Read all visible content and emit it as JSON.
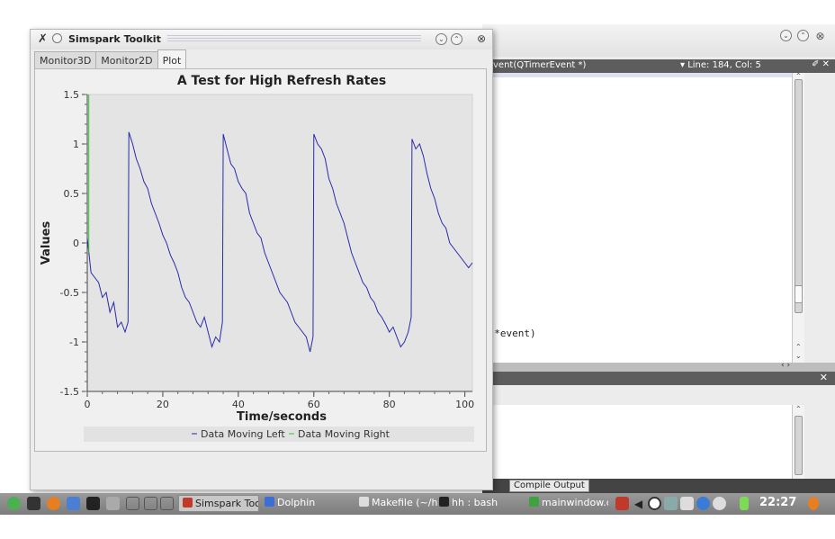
{
  "simspark_window": {
    "title": "Simspark Toolkit",
    "title_buttons": [
      "⌄",
      "⌃"
    ],
    "close": "⊗",
    "tabs": [
      {
        "label": "Monitor3D",
        "active": false
      },
      {
        "label": "Monitor2D",
        "active": false
      },
      {
        "label": "Plot",
        "active": true
      }
    ]
  },
  "chart_data": {
    "type": "line",
    "title": "A Test for High Refresh Rates",
    "xlabel": "Time/seconds",
    "ylabel": "Values",
    "xlim": [
      0,
      102
    ],
    "ylim": [
      -1.5,
      1.5
    ],
    "xticks": [
      0,
      20,
      40,
      60,
      80,
      100
    ],
    "yticks": [
      -1.5,
      -1,
      -0.5,
      0,
      0.5,
      1,
      1.5
    ],
    "grid": false,
    "legend": "bottom",
    "background": "#e4e4e4",
    "series": [
      {
        "name": "Data Moving Left",
        "color": "#2a2aa8",
        "x": [
          0,
          1,
          2,
          3,
          4,
          5,
          6,
          7,
          8,
          9,
          10,
          10.8,
          11,
          12,
          13,
          14,
          15,
          16,
          17,
          18,
          19,
          20,
          21,
          22,
          23,
          24,
          25,
          26,
          27,
          28,
          29,
          30,
          31,
          32,
          33,
          34,
          35,
          35.8,
          36,
          37,
          38,
          39,
          40,
          41,
          42,
          43,
          44,
          45,
          46,
          47,
          48,
          49,
          50,
          51,
          52,
          53,
          54,
          55,
          56,
          57,
          58,
          59,
          59.8,
          60,
          61,
          62,
          63,
          64,
          65,
          66,
          67,
          68,
          69,
          70,
          71,
          72,
          73,
          74,
          75,
          76,
          77,
          78,
          79,
          80,
          81,
          82,
          83,
          84,
          85,
          85.8,
          86,
          87,
          88,
          89,
          90,
          91,
          92,
          93,
          94,
          95,
          96,
          97,
          98,
          99,
          100,
          101,
          102
        ],
        "y": [
          0.05,
          -0.3,
          -0.35,
          -0.4,
          -0.55,
          -0.5,
          -0.7,
          -0.6,
          -0.85,
          -0.8,
          -0.9,
          -0.8,
          1.12,
          1.0,
          0.85,
          0.75,
          0.62,
          0.55,
          0.4,
          0.3,
          0.2,
          0.08,
          0.0,
          -0.12,
          -0.2,
          -0.3,
          -0.45,
          -0.55,
          -0.6,
          -0.7,
          -0.8,
          -0.85,
          -0.75,
          -0.9,
          -1.05,
          -0.95,
          -1.0,
          -0.8,
          1.1,
          0.95,
          0.8,
          0.75,
          0.62,
          0.55,
          0.5,
          0.3,
          0.2,
          0.1,
          0.05,
          -0.1,
          -0.2,
          -0.3,
          -0.4,
          -0.5,
          -0.55,
          -0.6,
          -0.7,
          -0.8,
          -0.85,
          -0.9,
          -0.95,
          -1.1,
          -0.95,
          1.1,
          1.0,
          0.95,
          0.85,
          0.65,
          0.55,
          0.4,
          0.3,
          0.2,
          0.05,
          -0.1,
          -0.2,
          -0.3,
          -0.4,
          -0.45,
          -0.55,
          -0.6,
          -0.7,
          -0.75,
          -0.82,
          -0.9,
          -0.85,
          -0.95,
          -1.05,
          -1.0,
          -0.9,
          -0.75,
          1.05,
          0.95,
          1.0,
          0.88,
          0.7,
          0.55,
          0.45,
          0.3,
          0.2,
          0.15,
          0.0,
          -0.05,
          -0.1,
          -0.15,
          -0.2,
          -0.25,
          -0.2
        ],
        "line": true
      },
      {
        "name": "Data Moving Right",
        "color": "#2ecc2e",
        "x": [
          0.4,
          0.4
        ],
        "y": [
          -0.1,
          1.5
        ],
        "line": true
      }
    ]
  },
  "editor_window": {
    "title_buttons": [
      "⌄",
      "⌃"
    ],
    "close": "⊗",
    "status_function": "vent(QTimerEvent *)",
    "status_linecol": "▾ Line: 184, Col: 5",
    "status_icons": "✐ ✕",
    "code_line": "t *event)",
    "hscroll_arrows": "‹ ›",
    "lower_close": "✕",
    "compile_tab": "Compile Output"
  },
  "taskbar": {
    "tasks": [
      {
        "label": "Simspark Tooli",
        "icon_color": "#c0392b",
        "active": true,
        "left": 198
      },
      {
        "label": "Dolphin",
        "icon_color": "#3a6fd8",
        "active": false,
        "left": 290
      },
      {
        "label": "Makefile (~/hh",
        "icon_color": "#dddddd",
        "active": false,
        "left": 395
      },
      {
        "label": "hh : bash",
        "icon_color": "#222222",
        "active": false,
        "left": 484
      },
      {
        "label": "mainwindow.cp",
        "icon_color": "#3fa23f",
        "active": false,
        "left": 584
      }
    ],
    "clock": "22:27"
  }
}
